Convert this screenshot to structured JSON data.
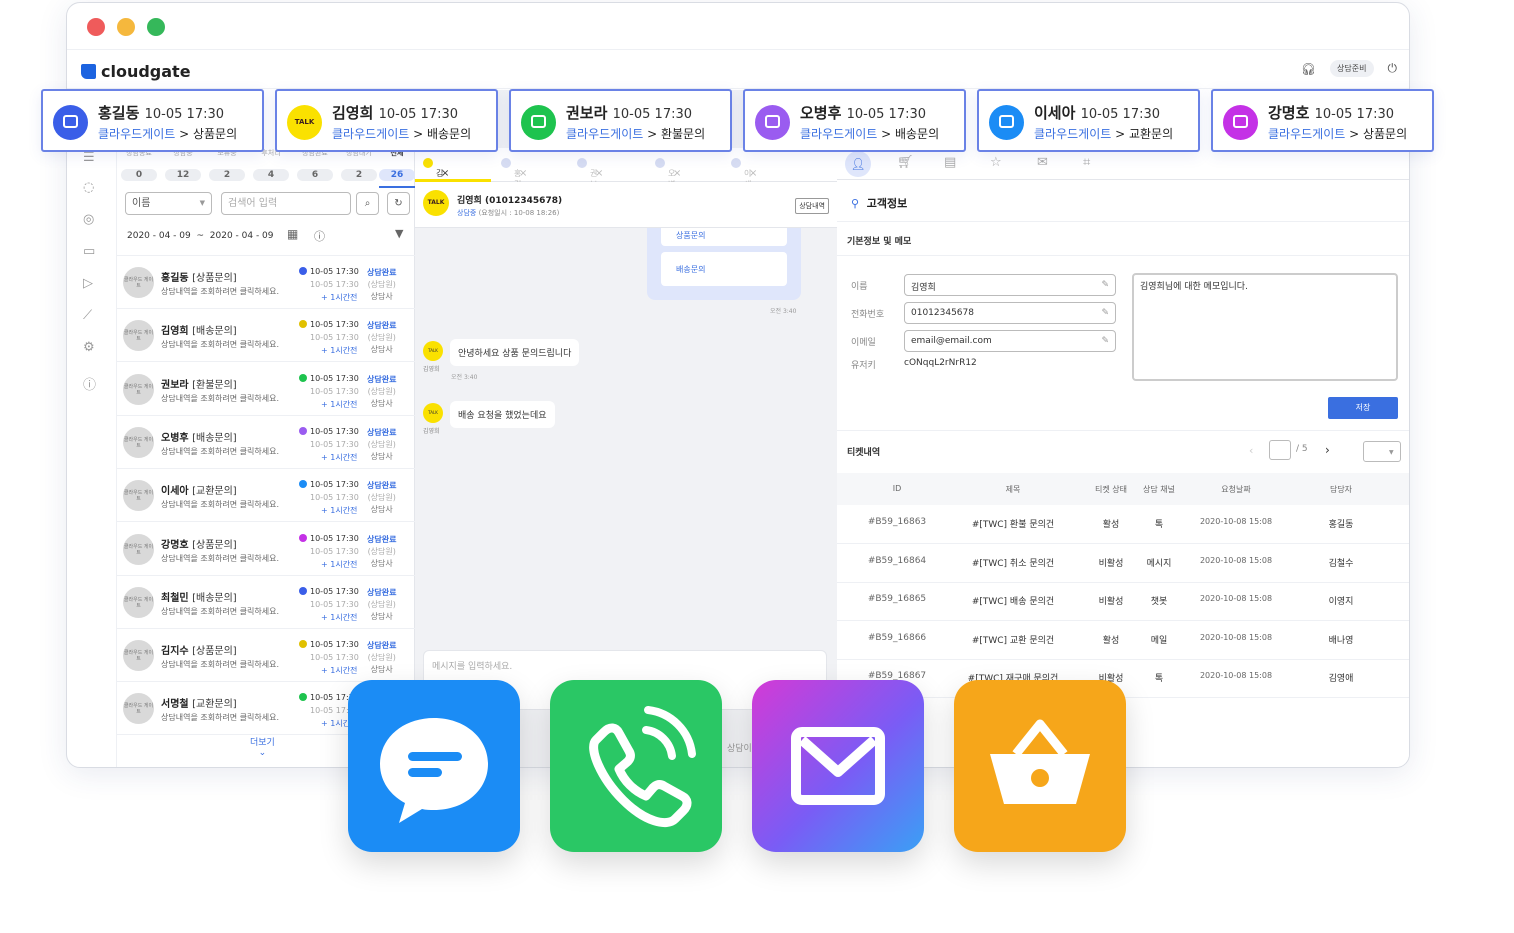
{
  "app": {
    "logo": "cloudgate",
    "status": "상담준비"
  },
  "cards": [
    {
      "name": "홍길동",
      "time": "10-05 17:30",
      "path": "클라우드게이트",
      "cat": "상품문의",
      "color": "#3a5ee8",
      "icon": "chat-bot-icon"
    },
    {
      "name": "김영희",
      "time": "10-05 17:30",
      "path": "클라우드게이트",
      "cat": "배송문의",
      "color": "#fae100",
      "icon": "kakao-talk-icon",
      "badge": "TALK"
    },
    {
      "name": "권보라",
      "time": "10-05 17:30",
      "path": "클라우드게이트",
      "cat": "환불문의",
      "color": "#1ec34e",
      "icon": "line-chat-icon"
    },
    {
      "name": "오병후",
      "time": "10-05 17:30",
      "path": "클라우드게이트",
      "cat": "배송문의",
      "color": "#9a5cf0",
      "icon": "mail-icon"
    },
    {
      "name": "이세아",
      "time": "10-05 17:30",
      "path": "클라우드게이트",
      "cat": "교환문의",
      "color": "#1b8cf5",
      "icon": "messenger-icon"
    },
    {
      "name": "강명호",
      "time": "10-05 17:30",
      "path": "클라우드게이트",
      "cat": "상품문의",
      "color": "#c431e6",
      "icon": "robot-icon"
    }
  ],
  "status_tabs": [
    {
      "label": "상담종료",
      "count": "0"
    },
    {
      "label": "상담중",
      "count": "12"
    },
    {
      "label": "보류중",
      "count": "2"
    },
    {
      "label": "후처리",
      "count": "4"
    },
    {
      "label": "상담완료",
      "count": "6"
    },
    {
      "label": "상담대기",
      "count": "2"
    },
    {
      "label": "전체",
      "count": "26"
    }
  ],
  "filter": {
    "field": "이름",
    "search_placeholder": "검색어 입력",
    "date_from": "2020 - 04 - 09",
    "date_sep": "~",
    "date_to": "2020 - 04 - 09"
  },
  "list": [
    {
      "name": "홍길동",
      "cat": "[상품문의]",
      "color": "#3a5ee8"
    },
    {
      "name": "김영희",
      "cat": "[배송문의]",
      "color": "#e0c000"
    },
    {
      "name": "권보라",
      "cat": "[환불문의]",
      "color": "#1ec34e"
    },
    {
      "name": "오병후",
      "cat": "[배송문의]",
      "color": "#9a5cf0"
    },
    {
      "name": "이세아",
      "cat": "[교환문의]",
      "color": "#1b8cf5"
    },
    {
      "name": "강명호",
      "cat": "[상품문의]",
      "color": "#c431e6"
    },
    {
      "name": "최철민",
      "cat": "[배송문의]",
      "color": "#3a5ee8"
    },
    {
      "name": "김지수",
      "cat": "[상품문의]",
      "color": "#e0c000"
    },
    {
      "name": "서명철",
      "cat": "[교환문의]",
      "color": "#1ec34e"
    }
  ],
  "list_common": {
    "avatar": "클라우드 게이트",
    "desc": "상담내역을 조회하려면 클릭하세요.",
    "time": "10-05 17:30",
    "time2": "10-05 17:30",
    "ago": "+ 1시간전",
    "state": "상담완료",
    "state2": "(상담원)",
    "state3": "상담사"
  },
  "more": "더보기",
  "chat_tabs": [
    "김영희",
    "홍길동",
    "권보라",
    "오병후",
    "이세아"
  ],
  "chat": {
    "header_name": "김영희 (01012345678)",
    "header_sub_status": "상담중",
    "header_sub": "(요청일시 : 10-08 18:26)",
    "history_btn": "상담내역",
    "menu_item1": "상품문의",
    "menu_item2": "배송문의",
    "time1": "오전 3:40",
    "msg1": "안녕하세요 상품 문의드립니다",
    "sender": "김영희",
    "time2": "오전 3:40",
    "msg2": "배송 요청을 했었는데요",
    "input_placeholder": "메시지를 입력하세요.",
    "side_label": "상담이"
  },
  "customer": {
    "title": "고객정보",
    "section": "기본정보 및 메모",
    "name_label": "이름",
    "name": "김영희",
    "phone_label": "전화번호",
    "phone": "01012345678",
    "email_label": "이메일",
    "email": "email@email.com",
    "key_label": "유저키",
    "key": "cONqqL2rNrR12",
    "memo": "김영희님에 대한 메모입니다.",
    "save": "저장"
  },
  "tickets": {
    "title": "티켓내역",
    "page_total": "/ 5",
    "headers": [
      "ID",
      "제목",
      "티켓 상태",
      "상담 채널",
      "요청날짜",
      "담당자"
    ],
    "rows": [
      [
        "#B59_16863",
        "#[TWC] 환불 문의건",
        "활성",
        "톡",
        "2020-10-08 15:08",
        "홍길동"
      ],
      [
        "#B59_16864",
        "#[TWC] 취소 문의건",
        "비활성",
        "메시지",
        "2020-10-08 15:08",
        "김철수"
      ],
      [
        "#B59_16865",
        "#[TWC] 배송 문의건",
        "비활성",
        "챗봇",
        "2020-10-08 15:08",
        "이영지"
      ],
      [
        "#B59_16866",
        "#[TWC] 교환 문의건",
        "활성",
        "메일",
        "2020-10-08 15:08",
        "배나영"
      ],
      [
        "#B59_16867",
        "#[TWC] 재구매 문의건",
        "비활성",
        "톡",
        "2020-10-08 15:08",
        "김영애"
      ]
    ]
  }
}
